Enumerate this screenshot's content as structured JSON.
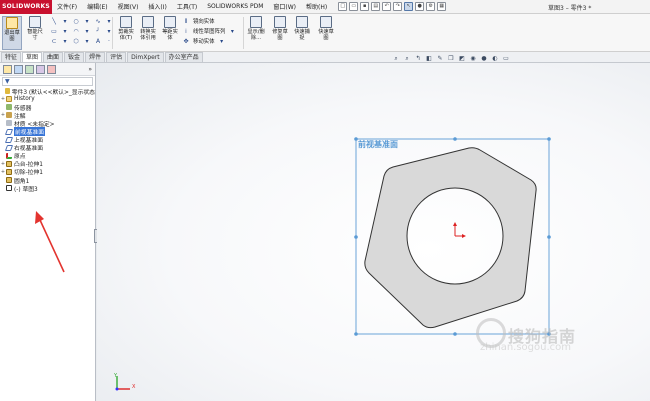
{
  "app": {
    "logo_text": "SOLIDWORKS",
    "window_title": "草图3 – 零件3 *"
  },
  "menu": [
    {
      "label": "文件(F)"
    },
    {
      "label": "编辑(E)"
    },
    {
      "label": "视图(V)"
    },
    {
      "label": "插入(I)"
    },
    {
      "label": "工具(T)"
    },
    {
      "label": "SOLIDWORKS PDM"
    },
    {
      "label": "窗口(W)"
    },
    {
      "label": "帮助(H)"
    }
  ],
  "toolbar": {
    "exit_sketch": "退出草图",
    "smart_dim": "智能尺寸",
    "trim": "剪裁实体(T)",
    "convert": "转换实体引用",
    "offset": "等距实体",
    "mirror": "镜向实体",
    "linear_pattern": "线性草图阵列",
    "move": "移动实体",
    "display_delete": "显示/删除...",
    "repair": "修复草图",
    "quick_snap": "快速捕捉",
    "rapid_sketch": "快速草图"
  },
  "tabs": [
    {
      "label": "特征"
    },
    {
      "label": "草图"
    },
    {
      "label": "曲面"
    },
    {
      "label": "钣金"
    },
    {
      "label": "焊件"
    },
    {
      "label": "评估"
    },
    {
      "label": "DimXpert"
    },
    {
      "label": "办公室产品"
    }
  ],
  "feature_tree": {
    "more": "»",
    "filter_icon": "funnel-icon",
    "items": [
      {
        "label": "零件3 (默认<<默认>_显示状态",
        "icon": "part",
        "expander": ""
      },
      {
        "label": "History",
        "icon": "folder",
        "expander": "+"
      },
      {
        "label": "传感器",
        "icon": "sensor",
        "expander": ""
      },
      {
        "label": "注解",
        "icon": "note",
        "expander": "+"
      },
      {
        "label": "材质 <未指定>",
        "icon": "mat",
        "expander": ""
      },
      {
        "label": "前视基准面",
        "icon": "plane",
        "expander": "",
        "selected": true
      },
      {
        "label": "上视基准面",
        "icon": "plane",
        "expander": ""
      },
      {
        "label": "右视基准面",
        "icon": "plane",
        "expander": ""
      },
      {
        "label": "原点",
        "icon": "origin",
        "expander": ""
      },
      {
        "label": "凸台-拉伸1",
        "icon": "feat",
        "expander": "+"
      },
      {
        "label": "切除-拉伸1",
        "icon": "feat",
        "expander": "+"
      },
      {
        "label": "圆角1",
        "icon": "feat",
        "expander": ""
      },
      {
        "label": "(-) 草图3",
        "icon": "sketch",
        "expander": ""
      }
    ]
  },
  "viewport": {
    "plane_label": "前视基准面",
    "watermark_cn": "搜狗指南",
    "watermark_en": "zhinan.sogou.com",
    "triad_x": "X",
    "triad_y": "Y"
  },
  "colors": {
    "selection": "#3875d7",
    "sketch_plane": "#5b9bd5",
    "annotation_arrow": "#e3342f",
    "hex_fill": "#d9d9d9"
  }
}
